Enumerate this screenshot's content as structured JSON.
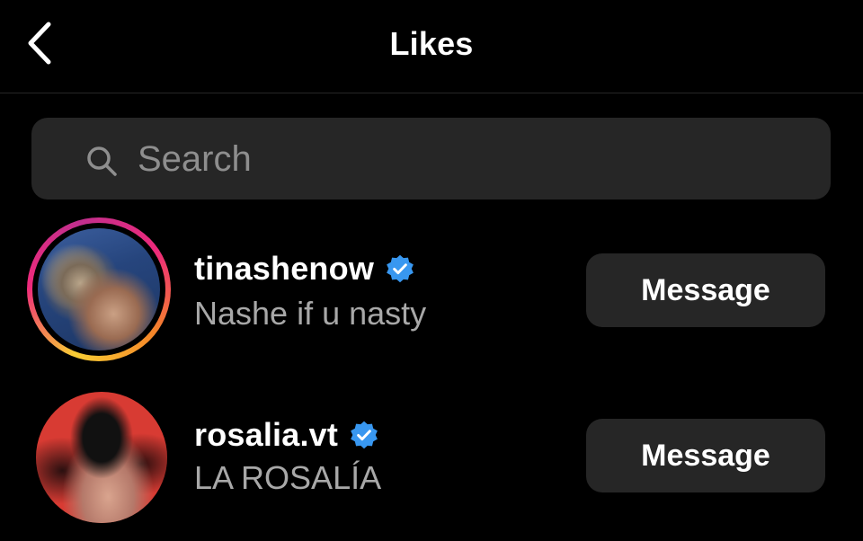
{
  "header": {
    "title": "Likes",
    "back_icon": "chevron-left-icon"
  },
  "search": {
    "placeholder": "Search",
    "value": "",
    "icon": "search-icon"
  },
  "users": [
    {
      "username": "tinashenow",
      "verified": true,
      "subtitle": "Nashe if u nasty",
      "button_label": "Message",
      "has_story_ring": true
    },
    {
      "username": "rosalia.vt",
      "verified": true,
      "subtitle": "LA ROSALÍA",
      "button_label": "Message",
      "has_story_ring": false
    }
  ],
  "colors": {
    "background": "#000000",
    "surface": "#262626",
    "verified_blue": "#3897f0",
    "secondary_text": "#a8a8a8"
  }
}
